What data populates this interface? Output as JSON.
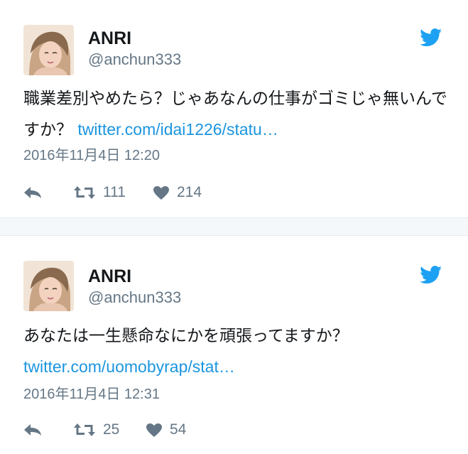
{
  "tweets": [
    {
      "name": "ANRI",
      "handle": "@anchun333",
      "text": "職業差別やめたら？じゃあなんの仕事がゴミじゃ無いんですか？ ",
      "link": "twitter.com/idai1226/statu…",
      "date": "2016年11月4日 12:20",
      "retweets": "111",
      "likes": "214"
    },
    {
      "name": "ANRI",
      "handle": "@anchun333",
      "text": "あなたは一生懸命なにかを頑張ってますか？",
      "link": "twitter.com/uomobyrap/stat…",
      "date": "2016年11月4日 12:31",
      "retweets": "25",
      "likes": "54"
    }
  ],
  "icons": {
    "brand": "twitter-bird-icon",
    "reply": "reply-icon",
    "retweet": "retweet-icon",
    "like": "heart-icon"
  },
  "colors": {
    "brand": "#1da1f2",
    "link": "#1b95e0",
    "text": "#14171a",
    "secondary": "#657786",
    "divider": "#e6ecf0"
  }
}
